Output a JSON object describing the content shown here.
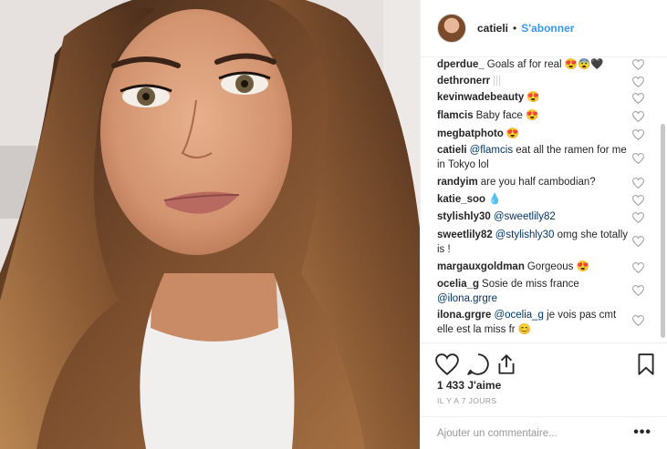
{
  "header": {
    "username": "catieli",
    "separator": "•",
    "follow_label": "S'abonner"
  },
  "comments": [
    {
      "user": "dperdue_",
      "text": "Goals af for real 😍😨🖤"
    },
    {
      "user": "dethronerr",
      "text": "|||"
    },
    {
      "user": "kevinwadebeauty",
      "text": "😍"
    },
    {
      "user": "flamcis",
      "text": "Baby face 😍"
    },
    {
      "user": "megbatphoto",
      "text": "😍"
    },
    {
      "user": "catieli",
      "mention": "@flamcis",
      "text": " eat all the ramen for me in Tokyo lol"
    },
    {
      "user": "randyim",
      "text": "are you half cambodian?"
    },
    {
      "user": "katie_soo",
      "text": "💧"
    },
    {
      "user": "stylishly30",
      "mention": "@sweetlily82",
      "text": ""
    },
    {
      "user": "sweetlily82",
      "mention": "@stylishly30",
      "text": " omg she totally is !"
    },
    {
      "user": "margauxgoldman",
      "text": "Gorgeous 😍"
    },
    {
      "user": "ocelia_g",
      "text": "Sosie de miss france ",
      "mention_after": "@ilona.grgre"
    },
    {
      "user": "ilona.grgre",
      "mention": "@ocelia_g",
      "text": " je vois pas cmt elle est la miss fr 😊"
    }
  ],
  "actions": {
    "likes": "1 433 J'aime",
    "time_ago": "Il y a 7 jours",
    "comment_placeholder": "Ajouter un commentaire...",
    "more_label": "•••"
  },
  "colors": {
    "link": "#3897f0",
    "mention": "#003569",
    "muted": "#999999",
    "border": "#efefef"
  }
}
